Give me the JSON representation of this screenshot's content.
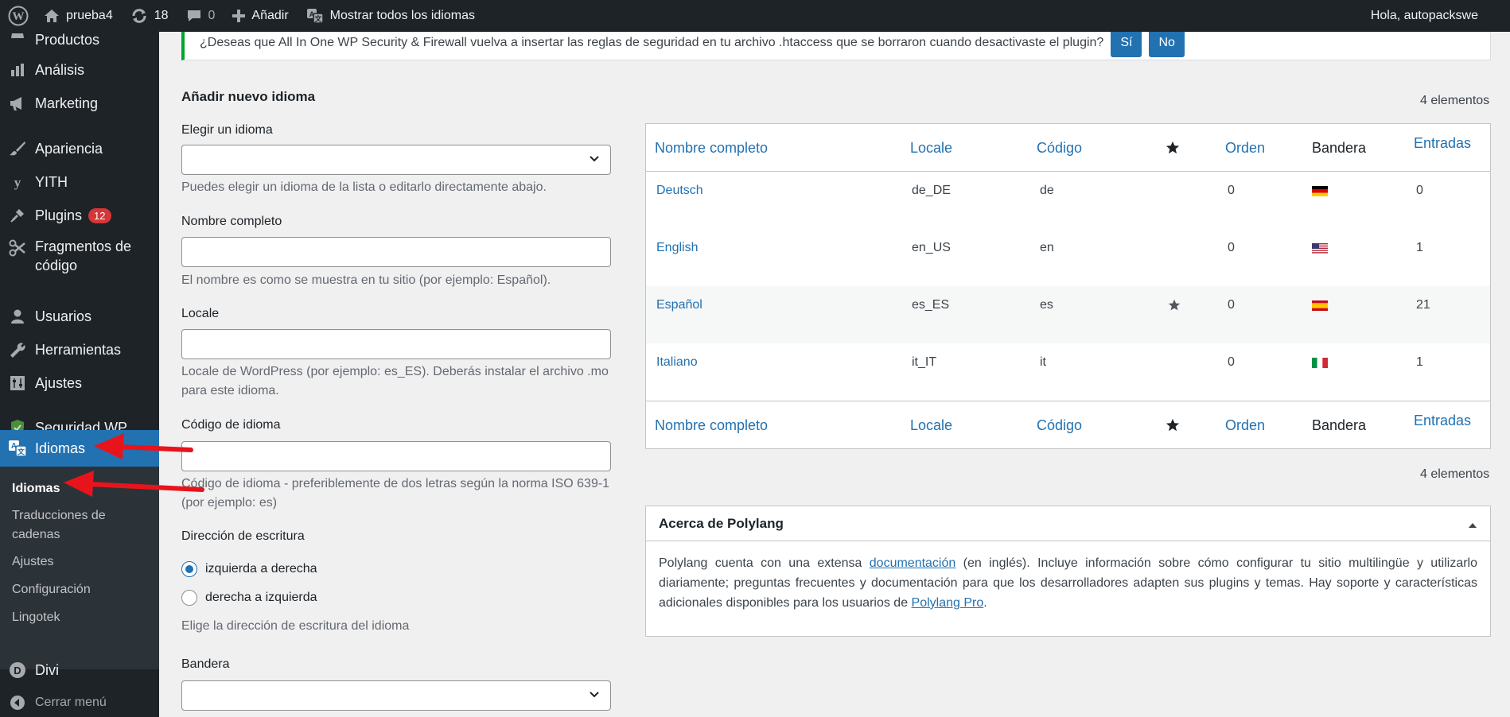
{
  "adminbar": {
    "site_name": "prueba4",
    "updates_count": "18",
    "comments_count": "0",
    "new_label": "Añadir",
    "lang_filter_label": "Mostrar todos los idiomas",
    "greeting": "Hola, autopackswe"
  },
  "sidebar": {
    "items": [
      {
        "label": "Productos",
        "icon": "products-icon"
      },
      {
        "label": "Análisis",
        "icon": "chart-icon"
      },
      {
        "label": "Marketing",
        "icon": "megaphone-icon"
      },
      {
        "label": "Apariencia",
        "icon": "brush-icon"
      },
      {
        "label": "YITH",
        "icon": "yith-icon"
      },
      {
        "label": "Plugins",
        "icon": "plugin-icon",
        "badge": "12"
      },
      {
        "label": "Fragmentos de código",
        "icon": "scissors-icon"
      },
      {
        "label": "Usuarios",
        "icon": "user-icon"
      },
      {
        "label": "Herramientas",
        "icon": "wrench-icon"
      },
      {
        "label": "Ajustes",
        "icon": "settings-icon"
      },
      {
        "label": "Seguridad WP",
        "icon": "shield-icon"
      },
      {
        "label": "Idiomas",
        "icon": "translate-icon"
      },
      {
        "label": "Divi",
        "icon": "divi-icon"
      }
    ],
    "submenu": [
      "Idiomas",
      "Traducciones de cadenas",
      "Ajustes",
      "Configuración",
      "Lingotek"
    ],
    "collapse_label": "Cerrar menú"
  },
  "notice": {
    "text": "¿Deseas que All In One WP Security & Firewall vuelva a insertar las reglas de seguridad en tu archivo .htaccess que se borraron cuando desactivaste el plugin?",
    "yes_label": "Sí",
    "no_label": "No"
  },
  "form": {
    "title": "Añadir nuevo idioma",
    "choose_label": "Elegir un idioma",
    "choose_help": "Puedes elegir un idioma de la lista o editarlo directamente abajo.",
    "name_label": "Nombre completo",
    "name_help": "El nombre es como se muestra en tu sitio (por ejemplo: Español).",
    "locale_label": "Locale",
    "locale_help": "Locale de WordPress (por ejemplo: es_ES). Deberás instalar el archivo .mo para este idioma.",
    "code_label": "Código de idioma",
    "code_help": "Código de idioma - preferiblemente de dos letras según la norma ISO 639-1 (por ejemplo: es)",
    "direction_label": "Dirección de escritura",
    "ltr_label": "izquierda a derecha",
    "rtl_label": "derecha a izquierda",
    "direction_help": "Elige la dirección de escritura del idioma",
    "flag_label": "Bandera"
  },
  "table": {
    "count_label": "4 elementos",
    "headers": {
      "name": "Nombre completo",
      "locale": "Locale",
      "code": "Código",
      "order": "Orden",
      "flag": "Bandera",
      "posts": "Entradas"
    },
    "rows": [
      {
        "name": "Deutsch",
        "locale": "de_DE",
        "code": "de",
        "default": false,
        "order": "0",
        "flag": "de",
        "posts": "0"
      },
      {
        "name": "English",
        "locale": "en_US",
        "code": "en",
        "default": false,
        "order": "0",
        "flag": "us",
        "posts": "1"
      },
      {
        "name": "Español",
        "locale": "es_ES",
        "code": "es",
        "default": true,
        "order": "0",
        "flag": "es",
        "posts": "21"
      },
      {
        "name": "Italiano",
        "locale": "it_IT",
        "code": "it",
        "default": false,
        "order": "0",
        "flag": "it",
        "posts": "1"
      }
    ]
  },
  "about": {
    "title": "Acerca de Polylang",
    "text_1": "Polylang cuenta con una extensa ",
    "link_doc": "documentación",
    "text_2": " (en inglés). Incluye información sobre cómo configurar tu sitio multilingüe y utilizarlo diariamente; preguntas frecuentes y documentación para que los desarrolladores adapten sus plugins y temas. Hay soporte y características adicionales disponibles para los usuarios de ",
    "link_pro": "Polylang Pro",
    "text_3": "."
  },
  "colors": {
    "accent": "#2271b1",
    "sidebar_bg": "#1d2327",
    "badge": "#d63638",
    "notice_border": "#00a32a",
    "annotation_arrow": "#e8141c"
  }
}
